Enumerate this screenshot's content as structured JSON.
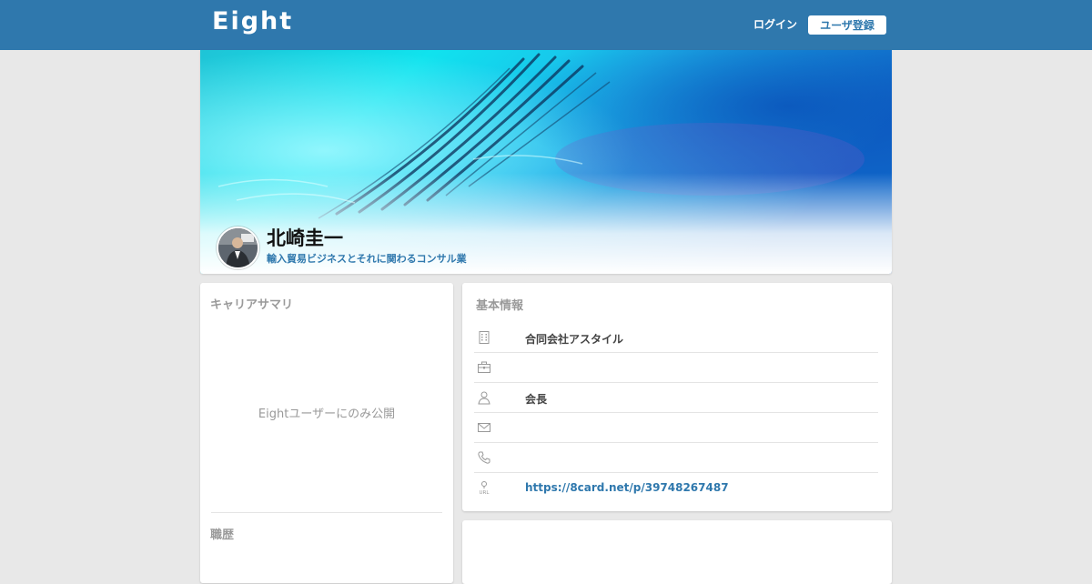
{
  "header": {
    "logo_text": "Eight",
    "login_label": "ログイン",
    "signup_label": "ユーザ登録",
    "brand_color": "#2f78ad"
  },
  "profile": {
    "name": "北崎圭一",
    "tagline": "輸入貿易ビジネスとそれに関わるコンサル業"
  },
  "career": {
    "title": "キャリアサマリ",
    "private_note": "Eightユーザーにのみ公開",
    "history_title": "職歴"
  },
  "basic_info": {
    "title": "基本情報",
    "rows": [
      {
        "icon": "building-icon",
        "value": ""
      },
      {
        "icon": "briefcase-icon",
        "value": ""
      },
      {
        "icon": "person-icon",
        "value": "会長"
      },
      {
        "icon": "mail-icon",
        "value": ""
      },
      {
        "icon": "phone-icon",
        "value": ""
      },
      {
        "icon": "url-icon",
        "value": "https://8card.net/p/39748267487"
      }
    ],
    "company": "合同会社アスタイル"
  }
}
